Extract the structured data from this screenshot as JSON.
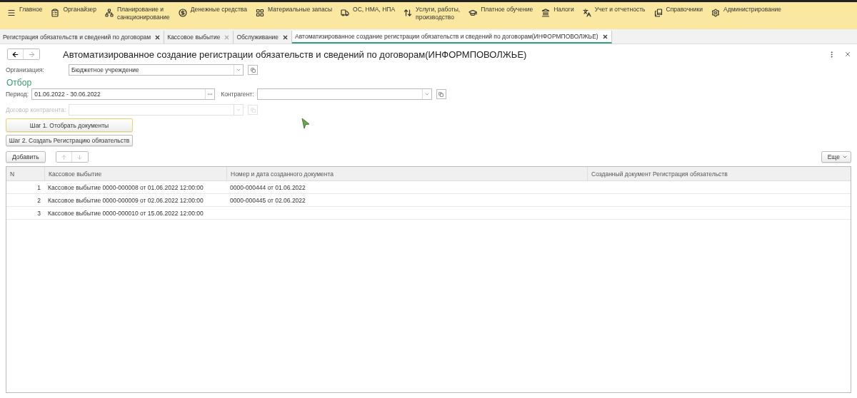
{
  "menu": [
    {
      "label": "Главное"
    },
    {
      "label": "Органайзер"
    },
    {
      "label": "Планирование и\nсанкционирование"
    },
    {
      "label": "Денежные средства"
    },
    {
      "label": "Материальные запасы"
    },
    {
      "label": "ОС, НМА, НПА"
    },
    {
      "label": "Услуги, работы,\nпроизводство"
    },
    {
      "label": "Платное обучение"
    },
    {
      "label": "Налоги"
    },
    {
      "label": "Учет и отчетность"
    },
    {
      "label": "Справочники"
    },
    {
      "label": "Администрирование"
    }
  ],
  "tabs": [
    {
      "label": "Регистрация обязательств и сведений по договорам",
      "selected": false,
      "close_dim": false
    },
    {
      "label": "Кассовое выбытие",
      "selected": false,
      "close_dim": true
    },
    {
      "label": "Обслуживание",
      "selected": false,
      "close_dim": false
    },
    {
      "label": "Автоматизированное создание регистрации обязательств и сведений по договорам(ИНФОРМПОВОЛЖЬЕ)",
      "selected": true,
      "close_dim": false
    }
  ],
  "form": {
    "title": "Автоматизированное создание регистрации обязательств и сведений по договорам(ИНФОРМПОВОЛЖЬЕ)",
    "organization": {
      "label": "Организация:",
      "value": "Бюджетное учреждение"
    },
    "filter_heading": "Отбор",
    "period": {
      "label": "Период:",
      "value": "01.06.2022 - 30.06.2022"
    },
    "counterparty": {
      "label": "Контрагент:"
    },
    "contract": {
      "label": "Договор контрагента:",
      "disabled": true
    },
    "step1": "Шаг 1. Отобрать документы",
    "step2": "Шаг 2. Создать Регистрацию обязательств",
    "add": "Добавить",
    "more": "Еще"
  },
  "table": {
    "columns": [
      "N",
      "Кассовое выбытие",
      "Номер и дата созданного документа",
      "Созданный документ Регистрация обязательств"
    ],
    "rows": [
      [
        "1",
        "Кассовое выбытие 0000-000008 от 01.06.2022 12:00:00",
        "0000-000444 от 01.06.2022",
        ""
      ],
      [
        "2",
        "Кассовое выбытие 0000-000009 от 02.06.2022 12:00:00",
        "0000-000445 от 02.06.2022",
        ""
      ],
      [
        "3",
        "Кассовое выбытие 0000-000010 от 15.06.2022 12:00:00",
        "",
        ""
      ]
    ]
  }
}
